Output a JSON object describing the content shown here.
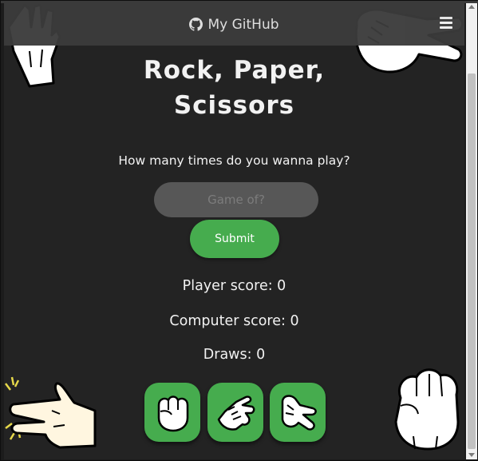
{
  "navbar": {
    "github_label": "My GitHub",
    "menu_icon": "hamburger-menu-icon",
    "github_icon": "github-icon"
  },
  "title": {
    "line1": "Rock, Paper,",
    "line2": "Scissors"
  },
  "prompt": {
    "question": "How many times do you wanna play?",
    "input_placeholder": "Game of?",
    "input_value": "",
    "submit_label": "Submit"
  },
  "scores": {
    "player": "Player score: 0",
    "computer": "Computer score: 0",
    "draws": "Draws: 0"
  },
  "choices": [
    {
      "name": "rock",
      "icon": "fist-hand-icon"
    },
    {
      "name": "paper",
      "icon": "open-hand-icon"
    },
    {
      "name": "scissors",
      "icon": "scissors-hand-icon"
    }
  ],
  "colors": {
    "background": "#232323",
    "navbar": "#3b3b3b",
    "accent_green": "#46ac4e",
    "input_bg": "#575757",
    "text": "#f2f2f2"
  }
}
